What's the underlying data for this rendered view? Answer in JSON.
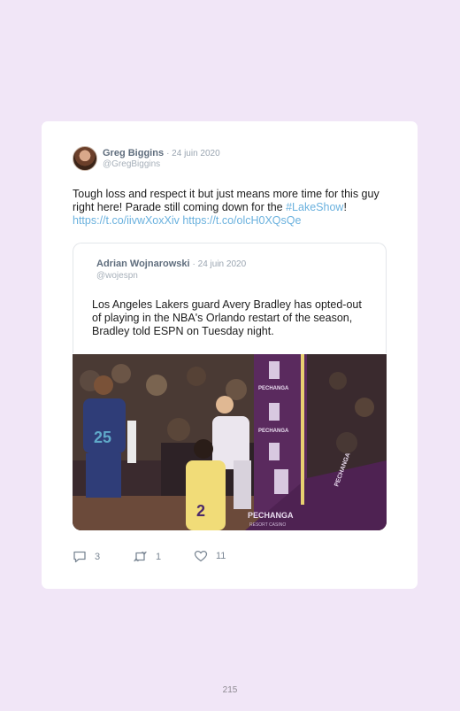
{
  "tweet": {
    "author_name": "Greg Biggins",
    "date": "· 24 juin 2020",
    "handle": "@GregBiggins",
    "text_main": "Tough loss and respect it but just means more time for this guy right here! Parade still coming down for the ",
    "hashtag": "#LakeShow",
    "text_end": "!",
    "link_1": "https://t.co/iivwXoxXiv",
    "link_2": "https://t.co/olcH0XQsQe"
  },
  "quoted_tweet": {
    "author_name": "Adrian Wojnarowski",
    "date": "· 24 juin 2020",
    "handle": "@wojespn",
    "text": "Los Angeles Lakers guard Avery Bradley has opted-out of playing in the NBA's Orlando restart of the season, Bradley told ESPN on Tuesday night."
  },
  "media": {
    "jersey_1": "25",
    "jersey_2": "2",
    "banner_1": "PECHANGA",
    "banner_2": "PECHANGA",
    "banner_3": "PECHANGA",
    "banner_4": "PECHANGA",
    "banner_sub": "RESORT CASINO"
  },
  "actions": {
    "replies": "3",
    "retweets": "1",
    "likes": "11"
  },
  "icons": [
    "reply-icon",
    "retweet-icon",
    "heart-icon"
  ],
  "page_number": "215"
}
